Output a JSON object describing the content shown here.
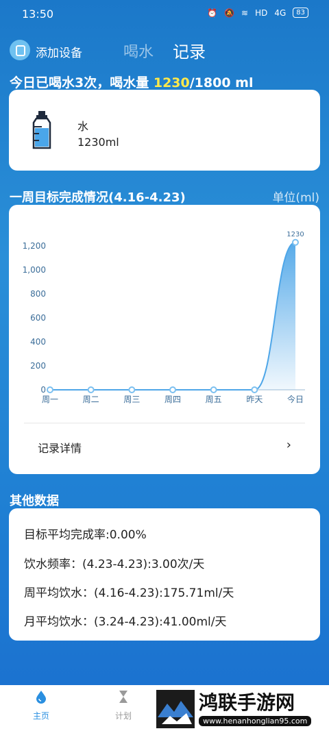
{
  "status_bar": {
    "time": "13:50",
    "network": "4G",
    "battery": "83",
    "hd": "HD"
  },
  "header": {
    "add_device": "添加设备",
    "tab_drink": "喝水",
    "tab_record": "记录"
  },
  "today": {
    "prefix": "今日已喝水3次，喝水量 ",
    "amount": "1230",
    "suffix": "/1800 ml"
  },
  "drink_card": {
    "name": "水",
    "amount": "1230ml"
  },
  "week": {
    "title": "一周目标完成情况(4.16-4.23)",
    "unit": "单位(ml)"
  },
  "chart_data": {
    "type": "area",
    "categories": [
      "周一",
      "周二",
      "周三",
      "周四",
      "周五",
      "昨天",
      "今日"
    ],
    "values": [
      0,
      0,
      0,
      0,
      0,
      0,
      1230
    ],
    "data_labels": [
      "",
      "",
      "",
      "",
      "",
      "",
      "1230"
    ],
    "yticks": [
      "0",
      "200",
      "400",
      "600",
      "800",
      "1,000",
      "1,200"
    ],
    "ylim": [
      0,
      1200
    ],
    "color": "#4ea6e8"
  },
  "record_detail": {
    "label": "记录详情",
    "chevron": "›"
  },
  "other": {
    "title": "其他数据",
    "stats": [
      "目标平均完成率:0.00%",
      "饮水频率：(4.23-4.23):3.00次/天",
      "周平均饮水：(4.16-4.23):175.71ml/天",
      "月平均饮水：(3.24-4.23):41.00ml/天"
    ]
  },
  "nav": {
    "home": "主页",
    "plan": "计划"
  },
  "watermark": {
    "main": "鸿联手游网",
    "sub": "www.henanhonglian95.com"
  }
}
